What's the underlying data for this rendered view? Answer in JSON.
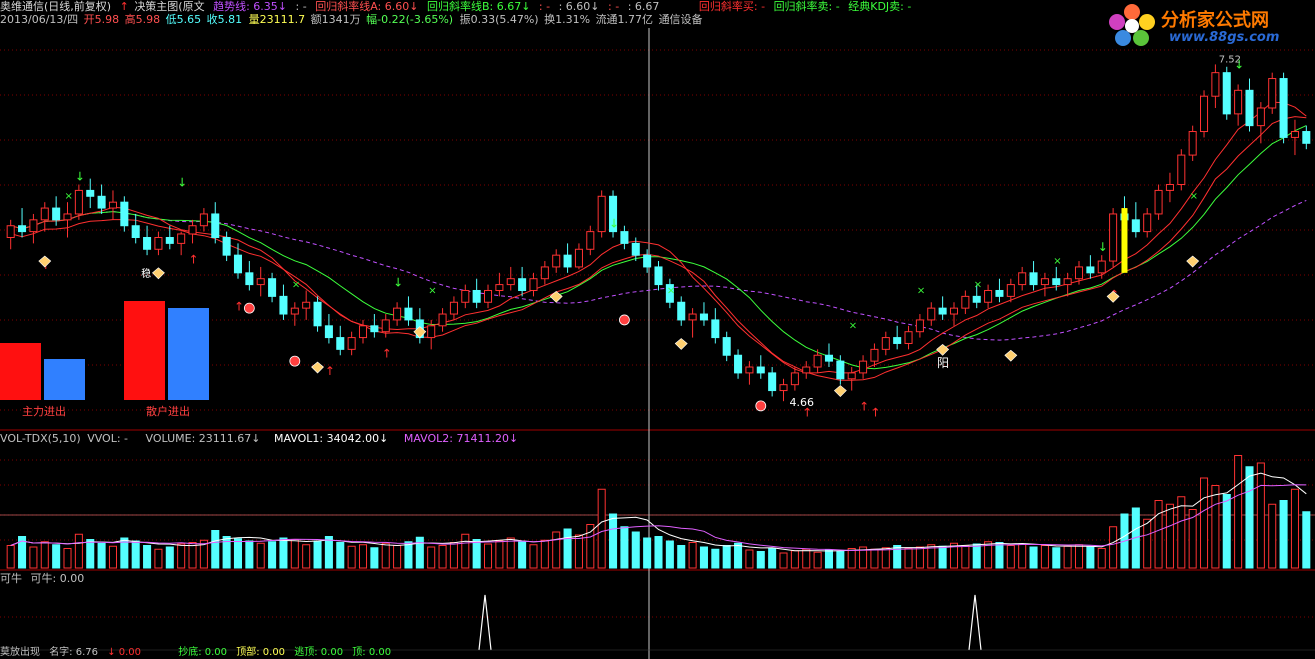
{
  "header": {
    "stock": "奥维通信(日线,前复权)",
    "arrow1": "↑",
    "formula": "决策主图(原文",
    "trend": "趋势线: 6.35↓",
    "blank1": ": -",
    "regA": "回归斜率线A: 6.60↓",
    "regB": "回归斜率线B: 6.67↓",
    "dash1": ": -",
    "v660": ": 6.60↓",
    "dash2": ": -",
    "v667": ": 6.67",
    "buy": "回归斜率买: -",
    "sell": "回归斜率卖: -",
    "kdj": "经典KDJ卖: -"
  },
  "quote": {
    "date": "2013/06/13/四",
    "open": "开5.98",
    "high": "高5.98",
    "low": "低5.65",
    "close": "收5.81",
    "volume": "量23111.7",
    "amount": "额1341万",
    "change": "幅-0.22(-3.65%)",
    "amplitude": "振0.33(5.47%)",
    "turnover": "换1.31%",
    "float": "流通1.77亿",
    "industry": "通信设备"
  },
  "labels": {
    "main_force": "主力进出",
    "retail": "散户进出",
    "low_price": "4.66",
    "yang": "阳",
    "high_price": "7.52",
    "wen": "稳"
  },
  "vol_header": {
    "title": "VOL-TDX(5,10)",
    "vvol": "VVOL: -",
    "volume": "VOLUME: 23111.67↓",
    "mavol1": "MAVOL1: 34042.00↓",
    "mavol2": "MAVOL2: 71411.20↓"
  },
  "ind_header": {
    "title": "可牛",
    "value": "可牛: 0.00"
  },
  "bottom": {
    "a": "莫放出现",
    "b": "名字: 6.76",
    "c": "↓ 0.00",
    "d": "抄底: 0.00",
    "e": "顶部: 0.00",
    "f": "逃顶: 0.00",
    "g": "顶: 0.00"
  },
  "logo": {
    "title": "分析家公式网",
    "url": "www.88gs.com"
  },
  "colors": {
    "up": "#ff3232",
    "down": "#54ffff",
    "ma_green": "#3cff3c",
    "ma_purple": "#c050ff",
    "grid": "#800000",
    "bar_red": "#ff1010",
    "bar_blue": "#3080ff",
    "yellow": "#ffff00"
  },
  "chart_data": {
    "type": "candlestick",
    "price_ylim": [
      4.5,
      7.6
    ],
    "candles": [
      [
        6.05,
        6.2,
        5.95,
        6.15
      ],
      [
        6.15,
        6.3,
        6.05,
        6.1
      ],
      [
        6.1,
        6.25,
        6.0,
        6.2
      ],
      [
        6.2,
        6.35,
        6.1,
        6.3
      ],
      [
        6.3,
        6.4,
        6.15,
        6.2
      ],
      [
        6.2,
        6.35,
        6.05,
        6.25
      ],
      [
        6.25,
        6.5,
        6.2,
        6.45
      ],
      [
        6.45,
        6.55,
        6.3,
        6.4
      ],
      [
        6.4,
        6.5,
        6.25,
        6.3
      ],
      [
        6.3,
        6.45,
        6.2,
        6.35
      ],
      [
        6.35,
        6.4,
        6.1,
        6.15
      ],
      [
        6.15,
        6.25,
        6.0,
        6.05
      ],
      [
        6.05,
        6.15,
        5.9,
        5.95
      ],
      [
        5.95,
        6.1,
        5.9,
        6.05
      ],
      [
        6.05,
        6.15,
        5.95,
        6.0
      ],
      [
        6.0,
        6.1,
        5.9,
        6.08
      ],
      [
        6.08,
        6.2,
        6.0,
        6.15
      ],
      [
        6.15,
        6.3,
        6.1,
        6.25
      ],
      [
        6.25,
        6.35,
        6.0,
        6.05
      ],
      [
        6.05,
        6.1,
        5.85,
        5.9
      ],
      [
        5.9,
        6.0,
        5.7,
        5.75
      ],
      [
        5.75,
        5.85,
        5.6,
        5.65
      ],
      [
        5.65,
        5.8,
        5.55,
        5.7
      ],
      [
        5.7,
        5.75,
        5.5,
        5.55
      ],
      [
        5.55,
        5.65,
        5.35,
        5.4
      ],
      [
        5.4,
        5.5,
        5.3,
        5.45
      ],
      [
        5.45,
        5.6,
        5.35,
        5.5
      ],
      [
        5.5,
        5.55,
        5.25,
        5.3
      ],
      [
        5.3,
        5.4,
        5.15,
        5.2
      ],
      [
        5.2,
        5.3,
        5.05,
        5.1
      ],
      [
        5.1,
        5.25,
        5.05,
        5.2
      ],
      [
        5.2,
        5.35,
        5.15,
        5.3
      ],
      [
        5.3,
        5.4,
        5.2,
        5.25
      ],
      [
        5.25,
        5.4,
        5.2,
        5.35
      ],
      [
        5.35,
        5.5,
        5.3,
        5.45
      ],
      [
        5.45,
        5.55,
        5.3,
        5.35
      ],
      [
        5.35,
        5.45,
        5.15,
        5.2
      ],
      [
        5.2,
        5.35,
        5.1,
        5.3
      ],
      [
        5.3,
        5.45,
        5.25,
        5.4
      ],
      [
        5.4,
        5.55,
        5.35,
        5.5
      ],
      [
        5.5,
        5.65,
        5.45,
        5.6
      ],
      [
        5.6,
        5.7,
        5.45,
        5.5
      ],
      [
        5.5,
        5.65,
        5.45,
        5.6
      ],
      [
        5.6,
        5.75,
        5.55,
        5.65
      ],
      [
        5.65,
        5.8,
        5.6,
        5.7
      ],
      [
        5.7,
        5.8,
        5.55,
        5.6
      ],
      [
        5.6,
        5.75,
        5.55,
        5.7
      ],
      [
        5.7,
        5.85,
        5.65,
        5.8
      ],
      [
        5.8,
        5.95,
        5.75,
        5.9
      ],
      [
        5.9,
        6.0,
        5.75,
        5.8
      ],
      [
        5.8,
        6.0,
        5.78,
        5.95
      ],
      [
        5.95,
        6.15,
        5.9,
        6.1
      ],
      [
        6.1,
        6.45,
        6.05,
        6.4
      ],
      [
        6.4,
        6.45,
        6.05,
        6.1
      ],
      [
        6.1,
        6.15,
        5.95,
        6.0
      ],
      [
        6.0,
        6.05,
        5.85,
        5.9
      ],
      [
        5.9,
        5.95,
        5.75,
        5.8
      ],
      [
        5.8,
        5.85,
        5.6,
        5.65
      ],
      [
        5.65,
        5.7,
        5.45,
        5.5
      ],
      [
        5.5,
        5.55,
        5.3,
        5.35
      ],
      [
        5.35,
        5.45,
        5.2,
        5.4
      ],
      [
        5.4,
        5.5,
        5.3,
        5.35
      ],
      [
        5.35,
        5.45,
        5.15,
        5.2
      ],
      [
        5.2,
        5.25,
        5.0,
        5.05
      ],
      [
        5.05,
        5.1,
        4.85,
        4.9
      ],
      [
        4.9,
        5.0,
        4.8,
        4.95
      ],
      [
        4.95,
        5.05,
        4.85,
        4.9
      ],
      [
        4.9,
        4.95,
        4.7,
        4.75
      ],
      [
        4.75,
        4.85,
        4.66,
        4.8
      ],
      [
        4.8,
        4.95,
        4.75,
        4.9
      ],
      [
        4.9,
        5.0,
        4.85,
        4.95
      ],
      [
        4.95,
        5.1,
        4.9,
        5.05
      ],
      [
        5.05,
        5.15,
        4.95,
        5.0
      ],
      [
        5.0,
        5.05,
        4.8,
        4.85
      ],
      [
        4.85,
        4.95,
        4.75,
        4.9
      ],
      [
        4.9,
        5.05,
        4.85,
        5.0
      ],
      [
        5.0,
        5.15,
        4.95,
        5.1
      ],
      [
        5.1,
        5.25,
        5.05,
        5.2
      ],
      [
        5.2,
        5.3,
        5.1,
        5.15
      ],
      [
        5.15,
        5.3,
        5.1,
        5.25
      ],
      [
        5.25,
        5.4,
        5.2,
        5.35
      ],
      [
        5.35,
        5.5,
        5.3,
        5.45
      ],
      [
        5.45,
        5.55,
        5.35,
        5.4
      ],
      [
        5.4,
        5.5,
        5.3,
        5.45
      ],
      [
        5.45,
        5.6,
        5.4,
        5.55
      ],
      [
        5.55,
        5.65,
        5.45,
        5.5
      ],
      [
        5.5,
        5.65,
        5.45,
        5.6
      ],
      [
        5.6,
        5.7,
        5.5,
        5.55
      ],
      [
        5.55,
        5.7,
        5.5,
        5.65
      ],
      [
        5.65,
        5.8,
        5.6,
        5.75
      ],
      [
        5.75,
        5.85,
        5.6,
        5.65
      ],
      [
        5.65,
        5.75,
        5.55,
        5.7
      ],
      [
        5.7,
        5.8,
        5.6,
        5.65
      ],
      [
        5.65,
        5.75,
        5.55,
        5.7
      ],
      [
        5.7,
        5.85,
        5.65,
        5.8
      ],
      [
        5.8,
        5.9,
        5.7,
        5.75
      ],
      [
        5.75,
        5.9,
        5.7,
        5.85
      ],
      [
        5.85,
        6.3,
        5.8,
        6.25
      ],
      [
        6.25,
        6.4,
        6.1,
        6.2
      ],
      [
        6.2,
        6.35,
        6.05,
        6.1
      ],
      [
        6.1,
        6.3,
        6.05,
        6.25
      ],
      [
        6.25,
        6.5,
        6.2,
        6.45
      ],
      [
        6.45,
        6.6,
        6.35,
        6.5
      ],
      [
        6.5,
        6.8,
        6.45,
        6.75
      ],
      [
        6.75,
        7.0,
        6.7,
        6.95
      ],
      [
        6.95,
        7.3,
        6.9,
        7.25
      ],
      [
        7.25,
        7.52,
        7.15,
        7.45
      ],
      [
        7.45,
        7.5,
        7.05,
        7.1
      ],
      [
        7.1,
        7.35,
        7.0,
        7.3
      ],
      [
        7.3,
        7.4,
        6.95,
        7.0
      ],
      [
        7.0,
        7.2,
        6.85,
        7.15
      ],
      [
        7.15,
        7.45,
        7.1,
        7.4
      ],
      [
        7.4,
        7.45,
        6.85,
        6.9
      ],
      [
        6.9,
        7.05,
        6.75,
        6.95
      ],
      [
        6.95,
        7.0,
        6.8,
        6.85
      ]
    ],
    "volume_ylim": [
      0,
      160000
    ],
    "volumes": [
      30000,
      42000,
      28000,
      35000,
      31000,
      26000,
      45000,
      38000,
      33000,
      29000,
      40000,
      36000,
      30000,
      25000,
      28000,
      32000,
      34000,
      37000,
      50000,
      42000,
      39000,
      36000,
      33000,
      35000,
      40000,
      38000,
      31000,
      36000,
      42000,
      34000,
      29000,
      31000,
      27000,
      33000,
      30000,
      35000,
      41000,
      28000,
      30000,
      34000,
      45000,
      38000,
      32000,
      36000,
      40000,
      35000,
      31000,
      37000,
      48000,
      52000,
      44000,
      58000,
      105000,
      72000,
      55000,
      48000,
      40000,
      42000,
      36000,
      30000,
      34000,
      28000,
      25000,
      30000,
      33000,
      24000,
      22000,
      26000,
      20000,
      23000,
      25000,
      21000,
      24000,
      22000,
      26000,
      28000,
      25000,
      27000,
      30000,
      26000,
      28000,
      31000,
      29000,
      33000,
      30000,
      32000,
      35000,
      34000,
      30000,
      32000,
      28000,
      30000,
      27000,
      29000,
      31000,
      28000,
      26000,
      55000,
      72000,
      80000,
      65000,
      90000,
      85000,
      95000,
      78000,
      120000,
      110000,
      98000,
      150000,
      135000,
      140000,
      85000,
      90000,
      105000,
      75000
    ]
  }
}
